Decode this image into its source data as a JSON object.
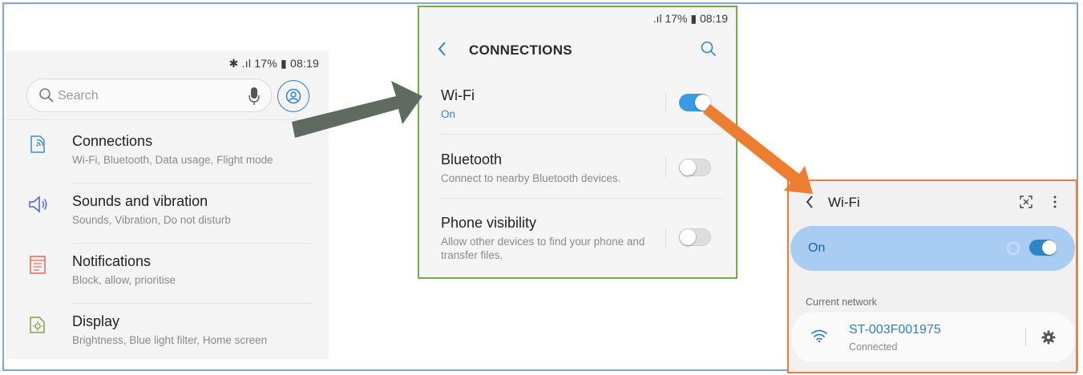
{
  "settings": {
    "status": "✱ .ıl 17% ▮ 08:19",
    "search_placeholder": "Search",
    "items": [
      {
        "title": "Connections",
        "subtitle": "Wi-Fi, Bluetooth, Data usage, Flight mode",
        "icon": "connections-icon"
      },
      {
        "title": "Sounds and vibration",
        "subtitle": "Sounds, Vibration, Do not disturb",
        "icon": "speaker-icon"
      },
      {
        "title": "Notifications",
        "subtitle": "Block, allow, prioritise",
        "icon": "notifications-icon"
      },
      {
        "title": "Display",
        "subtitle": "Brightness, Blue light filter, Home screen",
        "icon": "display-icon"
      }
    ]
  },
  "connections": {
    "status": ".ıl 17% ▮ 08:19",
    "title": "CONNECTIONS",
    "rows": [
      {
        "title": "Wi-Fi",
        "subtitle": "On",
        "enabled": true
      },
      {
        "title": "Bluetooth",
        "subtitle": "Connect to nearby Bluetooth devices.",
        "enabled": false
      },
      {
        "title": "Phone visibility",
        "subtitle": "Allow other devices to find your phone and transfer files.",
        "enabled": false
      }
    ]
  },
  "wifi": {
    "title": "Wi-Fi",
    "toggle_label": "On",
    "enabled": true,
    "current_network_label": "Current network",
    "network": {
      "name": "ST-003F001975",
      "status": "Connected"
    }
  },
  "colors": {
    "accent_blue": "#3a9be0",
    "connections_border": "#70ad47",
    "wifi_border": "#ed7d31",
    "arrow_dark": "#5f6b5f",
    "arrow_orange": "#ed7d31",
    "frame": "#7ea6d6"
  }
}
